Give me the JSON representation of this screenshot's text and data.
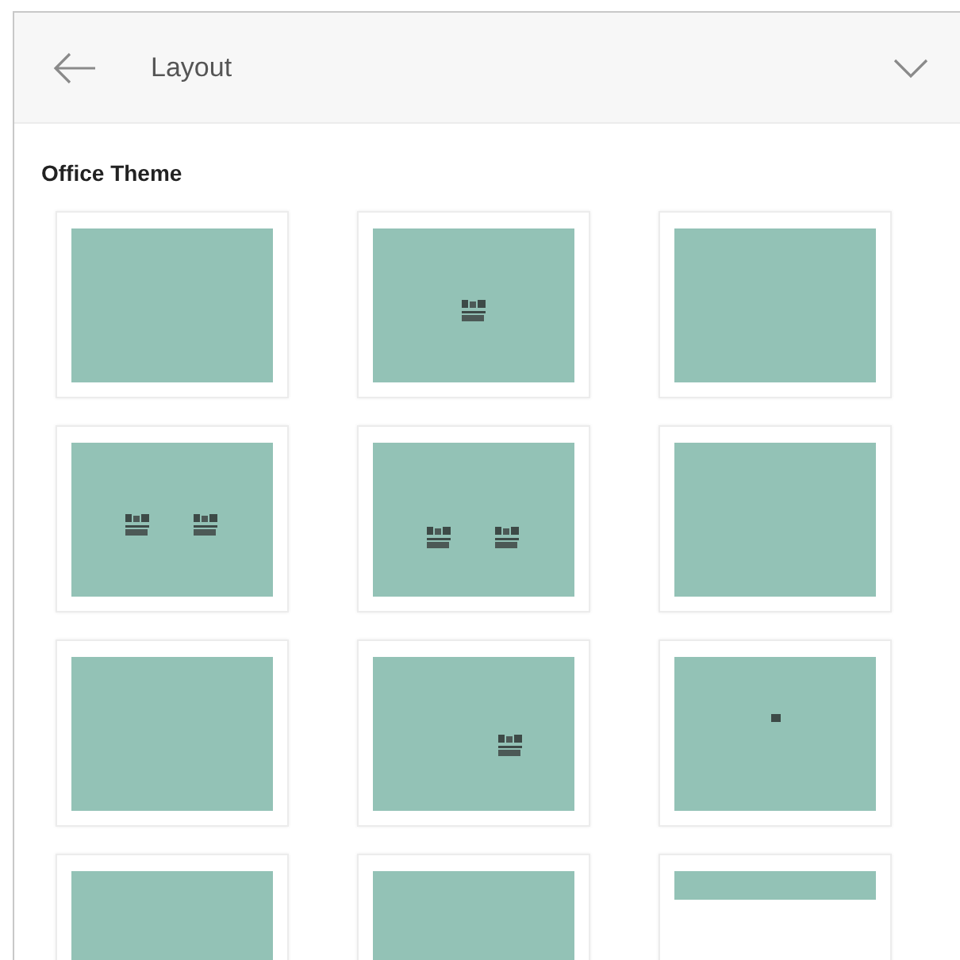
{
  "header": {
    "title": "Layout"
  },
  "section": {
    "title": "Office Theme"
  },
  "layouts": [
    {
      "kind": "blank",
      "selected": false
    },
    {
      "kind": "center",
      "selected": false
    },
    {
      "kind": "blank",
      "selected": false
    },
    {
      "kind": "two",
      "selected": false
    },
    {
      "kind": "two-low",
      "selected": false
    },
    {
      "kind": "blank",
      "selected": false
    },
    {
      "kind": "blank",
      "selected": false
    },
    {
      "kind": "right",
      "selected": false
    },
    {
      "kind": "dot",
      "selected": false
    },
    {
      "kind": "blank",
      "selected": false
    },
    {
      "kind": "blank",
      "selected": false
    },
    {
      "kind": "title-only",
      "selected": false
    }
  ]
}
